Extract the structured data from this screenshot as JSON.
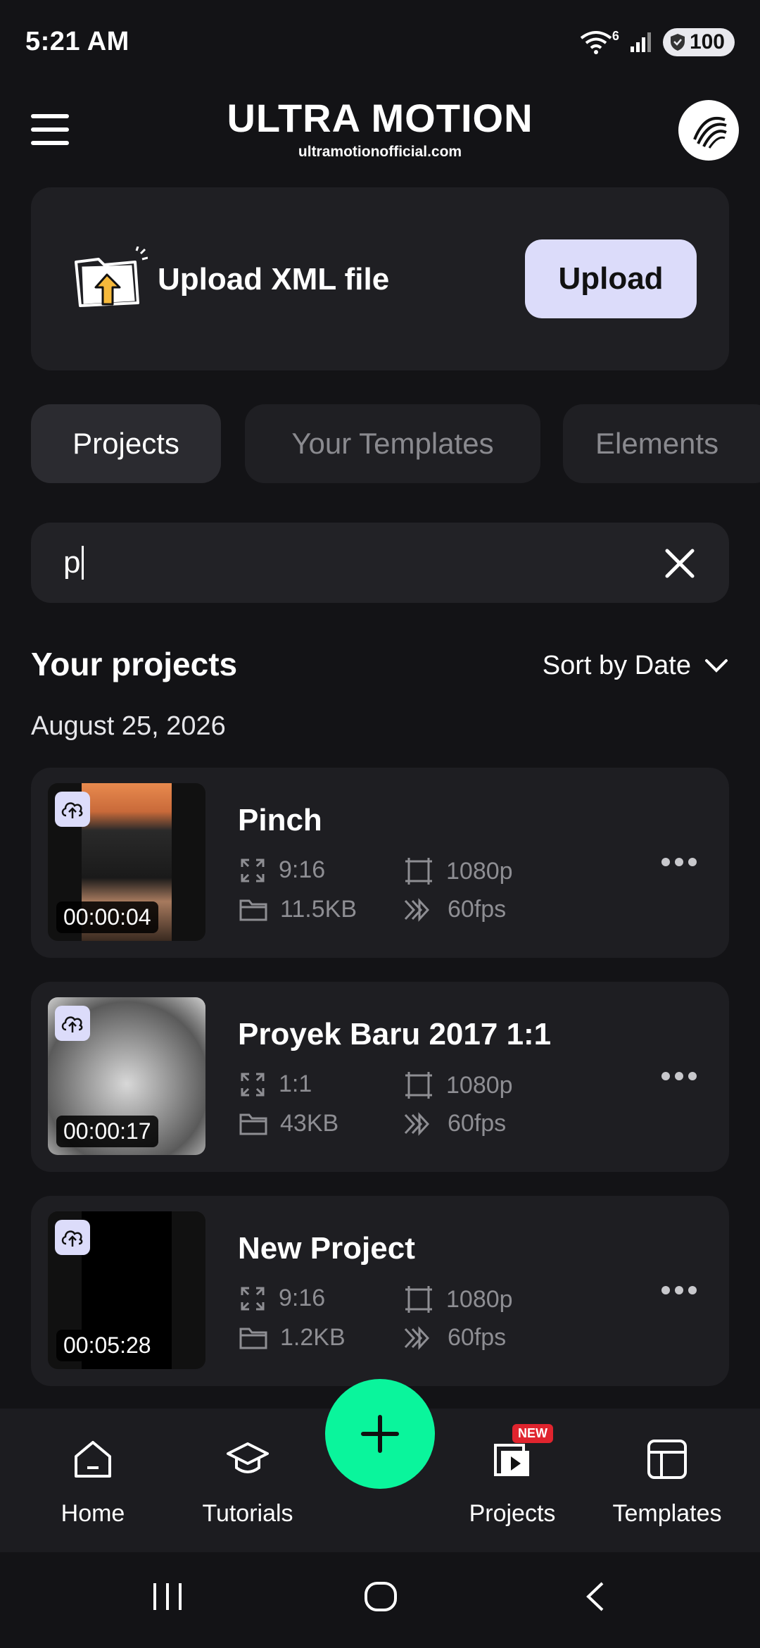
{
  "status_bar": {
    "time": "5:21 AM",
    "battery": "100",
    "network_badge": "6"
  },
  "header": {
    "title": "ULTRA MOTION",
    "subtitle": "ultramotionofficial.com"
  },
  "upload_card": {
    "label": "Upload XML file",
    "button": "Upload"
  },
  "tabs": [
    {
      "label": "Projects",
      "active": true
    },
    {
      "label": "Your Templates",
      "active": false
    },
    {
      "label": "Elements",
      "active": false
    }
  ],
  "search": {
    "value": "p"
  },
  "section": {
    "title": "Your projects",
    "sort_label": "Sort by Date",
    "date": "August 25, 2026"
  },
  "projects": [
    {
      "title": "Pinch",
      "duration": "00:00:04",
      "ratio": "9:16",
      "resolution": "1080p",
      "size": "11.5KB",
      "fps": "60fps"
    },
    {
      "title": "Proyek Baru 2017 1:1",
      "duration": "00:00:17",
      "ratio": "1:1",
      "resolution": "1080p",
      "size": "43KB",
      "fps": "60fps"
    },
    {
      "title": "New Project",
      "duration": "00:05:28",
      "ratio": "9:16",
      "resolution": "1080p",
      "size": "1.2KB",
      "fps": "60fps"
    }
  ],
  "bottom_nav": {
    "home": "Home",
    "tutorials": "Tutorials",
    "projects": "Projects",
    "projects_badge": "NEW",
    "templates": "Templates"
  },
  "colors": {
    "accent": "#0af59c",
    "button_light": "#dcdcfa",
    "badge_red": "#e0242e",
    "background": "#131316"
  }
}
